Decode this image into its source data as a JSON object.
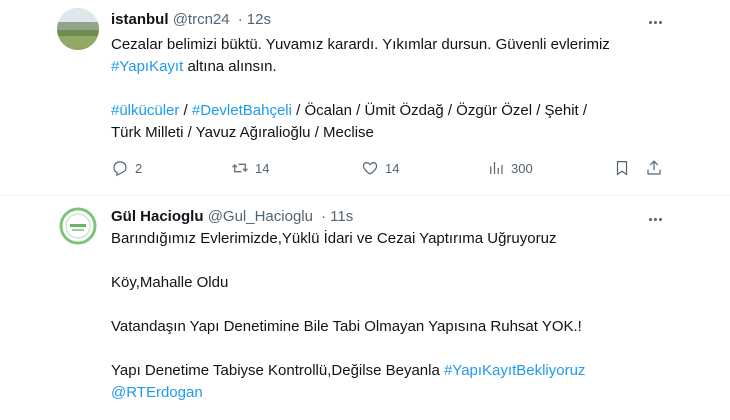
{
  "tweets": [
    {
      "display_name": "istanbul",
      "handle": "@trcn24",
      "separator": "·",
      "time": "12s",
      "lines": [
        [
          "Cezalar belimizi büktü. Yuvamız karardı. Yıkımlar dursun. Güvenli evlerimiz"
        ],
        [
          "#YapıKayıt",
          " altına alınsın."
        ],
        [],
        [
          "#ülkücüler",
          " / ",
          "#DevletBahçeli",
          " / Öcalan / Ümit Özdağ / Özgür Özel / Şehit /"
        ],
        [
          "Türk Milleti / Yavuz Ağıralioğlu / Meclise"
        ]
      ],
      "replies": "2",
      "retweets": "14",
      "likes": "14",
      "views": "300"
    },
    {
      "display_name": "Gül Hacioglu",
      "handle": "@Gul_Hacioglu",
      "separator": "·",
      "time": "11s",
      "lines": [
        [
          "Barındığımız Evlerimizde,Yüklü İdari ve Cezai Yaptırıma Uğruyoruz"
        ],
        [],
        [
          "Köy,Mahalle Oldu"
        ],
        [],
        [
          "Vatandaşın Yapı Denetimine Bile Tabi Olmayan Yapısına Ruhsat YOK.!"
        ],
        [],
        [
          "Yapı Denetime Tabiyse Kontrollü,Değilse Beyanla ",
          "#YapıKayıtBekliyoruz"
        ],
        [
          "@RTErdogan"
        ]
      ]
    }
  ],
  "colors": {
    "link": "#1d9bf0",
    "muted": "#536471",
    "text": "#0f1419"
  },
  "icons": [
    "more-icon",
    "reply-icon",
    "retweet-icon",
    "like-icon",
    "views-icon",
    "bookmark-icon",
    "share-icon"
  ]
}
